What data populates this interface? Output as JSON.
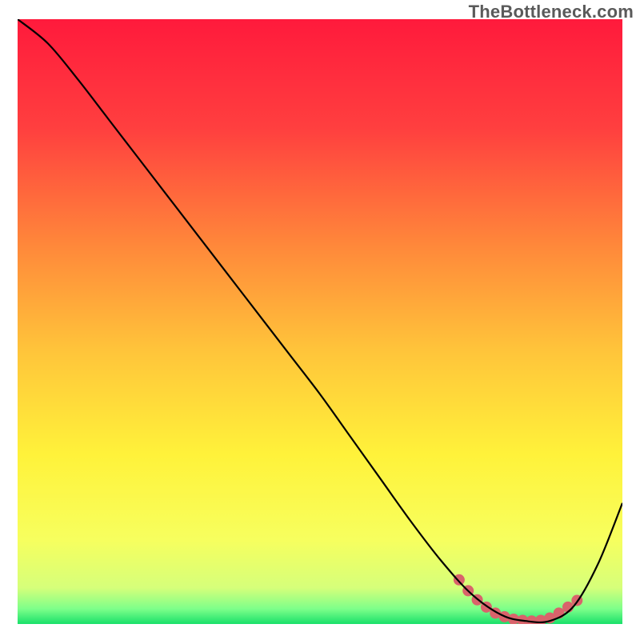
{
  "watermark": "TheBottleneck.com",
  "chart_data": {
    "type": "line",
    "title": "",
    "xlabel": "",
    "ylabel": "",
    "xlim": [
      0,
      100
    ],
    "ylim": [
      0,
      100
    ],
    "grid": false,
    "x": [
      0,
      5,
      10,
      15,
      20,
      25,
      30,
      35,
      40,
      45,
      50,
      55,
      60,
      65,
      70,
      75,
      80,
      84,
      88,
      92,
      96,
      100
    ],
    "values": [
      100,
      96,
      90,
      83.5,
      77,
      70.5,
      64,
      57.5,
      51,
      44.5,
      38,
      31,
      24,
      17,
      10.5,
      5,
      1.5,
      0.5,
      0.5,
      3,
      10,
      20
    ],
    "series": [
      {
        "name": "curve",
        "x": [
          0,
          5,
          10,
          15,
          20,
          25,
          30,
          35,
          40,
          45,
          50,
          55,
          60,
          65,
          70,
          75,
          80,
          84,
          88,
          92,
          96,
          100
        ],
        "values": [
          100,
          96,
          90,
          83.5,
          77,
          70.5,
          64,
          57.5,
          51,
          44.5,
          38,
          31,
          24,
          17,
          10.5,
          5,
          1.5,
          0.5,
          0.5,
          3,
          10,
          20
        ]
      },
      {
        "name": "highlight-dots",
        "x": [
          73,
          74.5,
          76,
          77.5,
          79,
          80.5,
          82,
          83.5,
          85,
          86.5,
          88,
          89.5,
          91,
          92.5
        ],
        "values": [
          7.3,
          5.5,
          4,
          2.8,
          1.8,
          1.2,
          0.8,
          0.6,
          0.5,
          0.6,
          1,
          1.8,
          2.8,
          3.9
        ]
      }
    ],
    "background": {
      "type": "vertical-gradient",
      "stops": [
        {
          "offset": 0.0,
          "color": "#ff1a3c"
        },
        {
          "offset": 0.18,
          "color": "#ff3f3f"
        },
        {
          "offset": 0.38,
          "color": "#ff8a3a"
        },
        {
          "offset": 0.55,
          "color": "#ffc53a"
        },
        {
          "offset": 0.72,
          "color": "#fff23a"
        },
        {
          "offset": 0.86,
          "color": "#f7ff5e"
        },
        {
          "offset": 0.94,
          "color": "#d6ff7a"
        },
        {
          "offset": 0.975,
          "color": "#7dff8a"
        },
        {
          "offset": 1.0,
          "color": "#19e06a"
        }
      ]
    },
    "curve_color": "#000000",
    "dot_color": "#d9636b",
    "dot_radius": 7
  }
}
